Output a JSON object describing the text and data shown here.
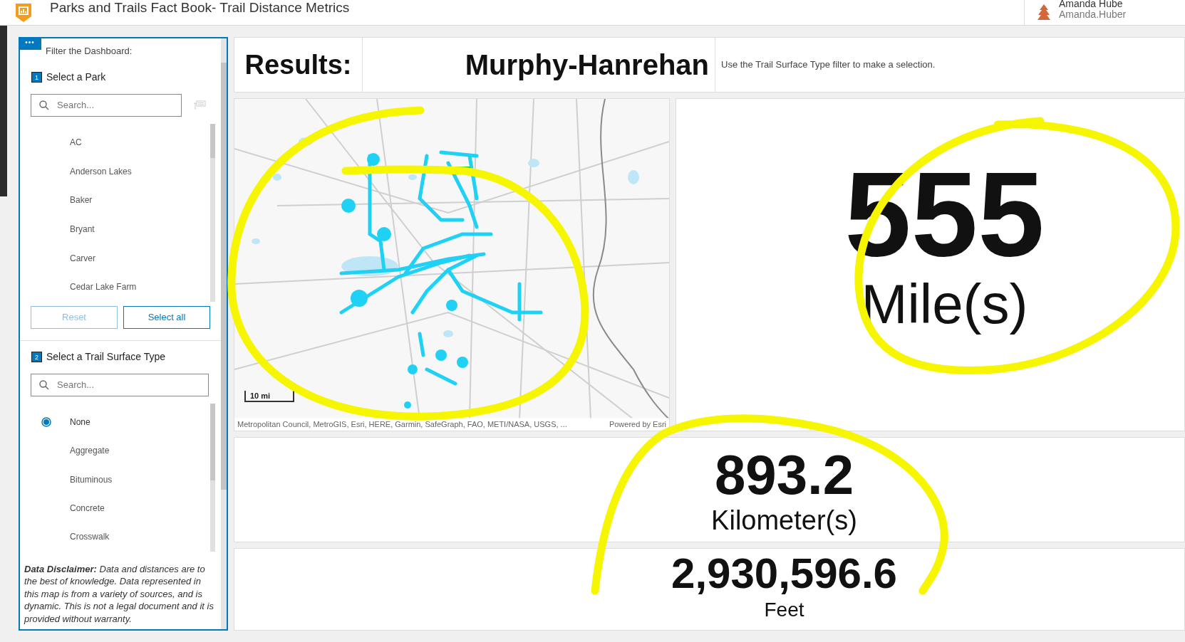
{
  "app_bar": {
    "title": "Parks and Trails Fact Book- Trail Distance Metrics",
    "user": {
      "name": "Amanda Hube",
      "username": "Amanda.Huber"
    }
  },
  "filter_panel": {
    "menu_glyph": "•••",
    "title": "Filter the Dashboard:",
    "sections": [
      {
        "number": "1",
        "title": "Select a Park",
        "search": {
          "placeholder": "Search..."
        },
        "items": [
          {
            "label": "AC",
            "selected": false
          },
          {
            "label": "Anderson Lakes",
            "selected": false
          },
          {
            "label": "Baker",
            "selected": false
          },
          {
            "label": "Bryant",
            "selected": false
          },
          {
            "label": "Carver",
            "selected": false
          },
          {
            "label": "Cedar Lake Farm",
            "selected": false
          }
        ],
        "buttons": [
          {
            "label": "Reset",
            "disabled": true
          },
          {
            "label": "Select all",
            "disabled": false
          }
        ]
      },
      {
        "number": "2",
        "title": "Select a Trail Surface Type",
        "search": {
          "placeholder": "Search..."
        },
        "items": [
          {
            "label": "None",
            "selected": true
          },
          {
            "label": "Aggregate",
            "selected": false
          },
          {
            "label": "Bituminous",
            "selected": false
          },
          {
            "label": "Concrete",
            "selected": false
          },
          {
            "label": "Crosswalk",
            "selected": false
          }
        ]
      }
    ],
    "disclaimer": "**Data Disclaimer:** Data and distances are to the best of knowledge. Data represented in this map is from a variety of sources, and is dynamic. This is not a legal document and it is provided without warranty."
  },
  "results": {
    "label": "Results:",
    "park": "Murphy-Hanrehan",
    "message": "Use the Trail Surface Type filter to make a selection."
  },
  "map": {
    "scale": "10 mi",
    "attribution": "Metropolitan Council, MetroGIS, Esri, HERE, Garmin, SafeGraph, FAO, METI/NASA, USGS, ...",
    "powered_by": "Powered by Esri"
  },
  "metrics": [
    {
      "value": "555",
      "unit": "Mile(s)"
    },
    {
      "value": "893.2",
      "unit": "Kilometer(s)"
    },
    {
      "value": "2,930,596.6",
      "unit": "Feet"
    }
  ]
}
